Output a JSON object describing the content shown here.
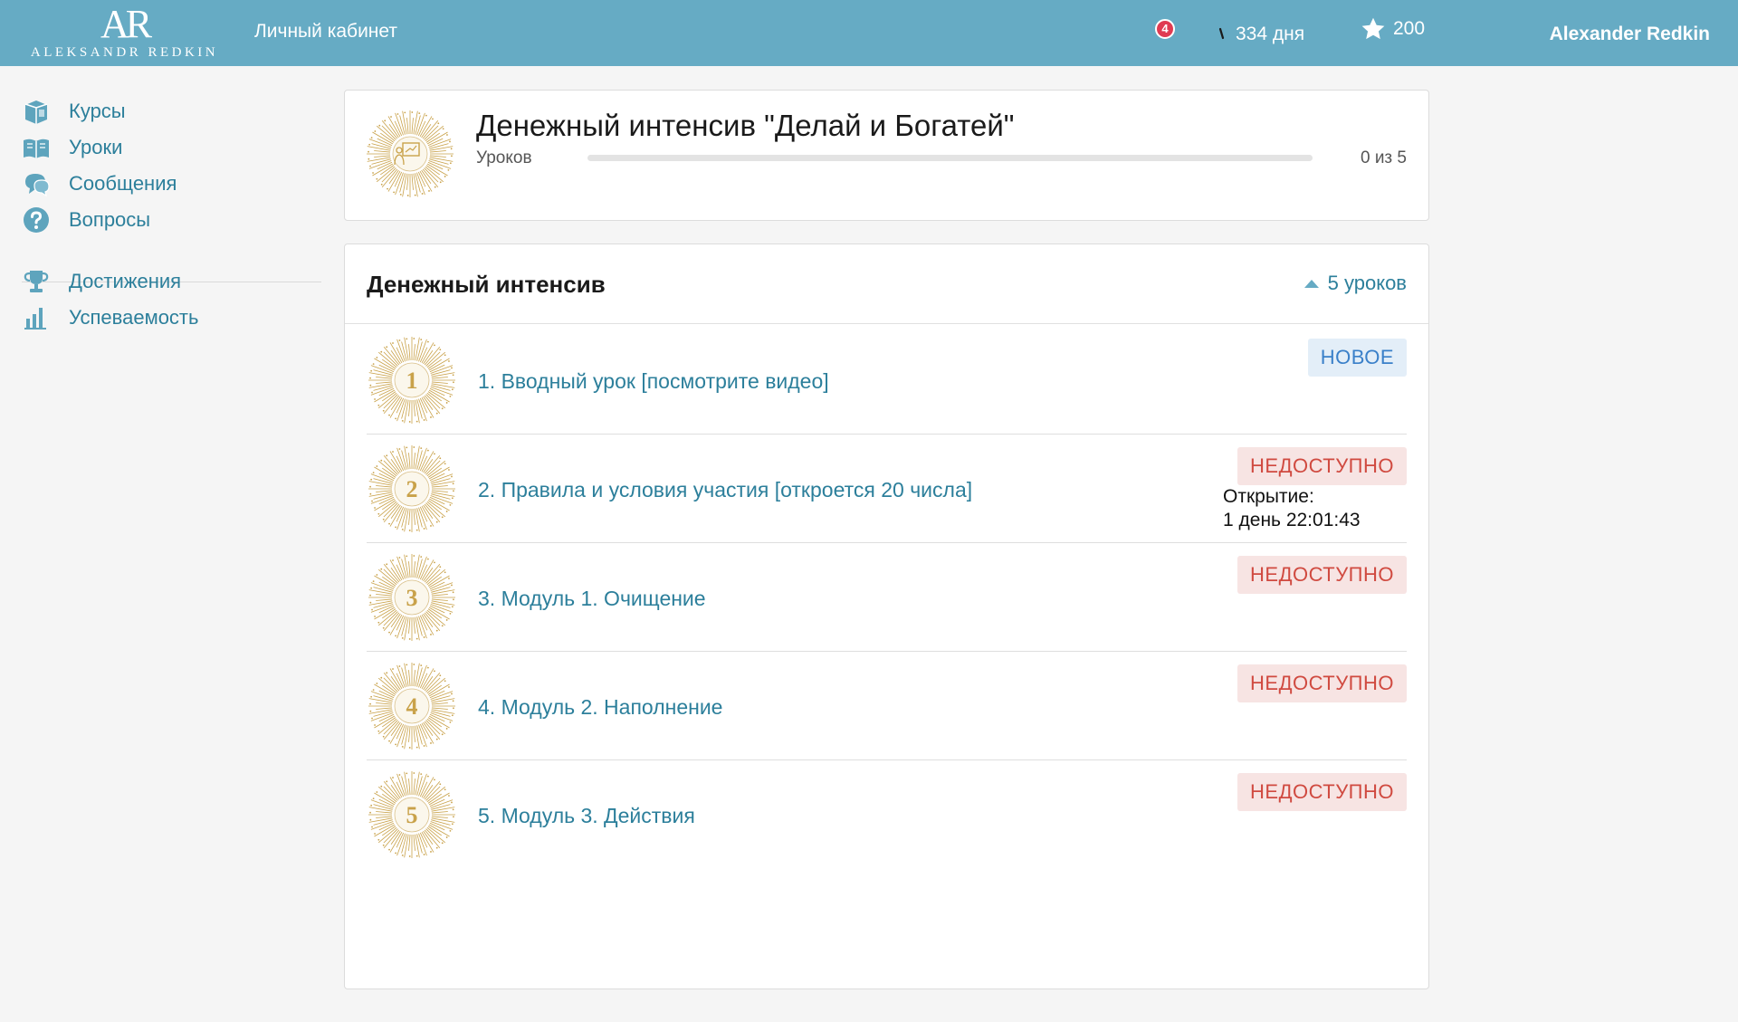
{
  "header": {
    "logo_mark": "AR",
    "logo_text": "ALEKSANDR REDKIN",
    "cabinet_label": "Личный кабинет",
    "notifications_count": "4",
    "streak_days": "334 дня",
    "points": "200",
    "user_name": "Alexander Redkin"
  },
  "sidebar": {
    "items": [
      {
        "label": "Курсы",
        "icon": "courses-icon"
      },
      {
        "label": "Уроки",
        "icon": "book-icon"
      },
      {
        "label": "Сообщения",
        "icon": "messages-icon"
      },
      {
        "label": "Вопросы",
        "icon": "question-icon"
      },
      {
        "label": "Достижения",
        "icon": "trophy-icon"
      },
      {
        "label": "Успеваемость",
        "icon": "bar-chart-icon"
      }
    ]
  },
  "course": {
    "title": "Денежный интенсив \"Делай и Богатей\"",
    "progress_label": "Уроков",
    "progress_count": "0 из 5",
    "progress_fraction": 0
  },
  "module": {
    "title": "Денежный интенсив",
    "lessons_count": "5 уроков",
    "lessons": [
      {
        "number": "1",
        "title": "1. Вводный урок [посмотрите видео]",
        "status": "НОВОЕ",
        "status_type": "new"
      },
      {
        "number": "2",
        "title": "2. Правила и условия участия [откроется 20 числа]",
        "status": "НЕДОСТУПНО",
        "status_type": "locked",
        "opening_label": "Открытие:",
        "opening_time": "1 день 22:01:43"
      },
      {
        "number": "3",
        "title": "3. Модуль 1. Очищение",
        "status": "НЕДОСТУПНО",
        "status_type": "locked"
      },
      {
        "number": "4",
        "title": "4. Модуль 2. Наполнение",
        "status": "НЕДОСТУПНО",
        "status_type": "locked"
      },
      {
        "number": "5",
        "title": "5. Модуль 3. Действия",
        "status": "НЕДОСТУПНО",
        "status_type": "locked"
      }
    ]
  },
  "colors": {
    "header_bg": "#66abc4",
    "link": "#2c7f9b",
    "badge_new_bg": "#e3eef8",
    "badge_new_text": "#3a80c9",
    "badge_locked_bg": "#f7e4e3",
    "badge_locked_text": "#d04a40",
    "gold": "#c9a24a"
  }
}
